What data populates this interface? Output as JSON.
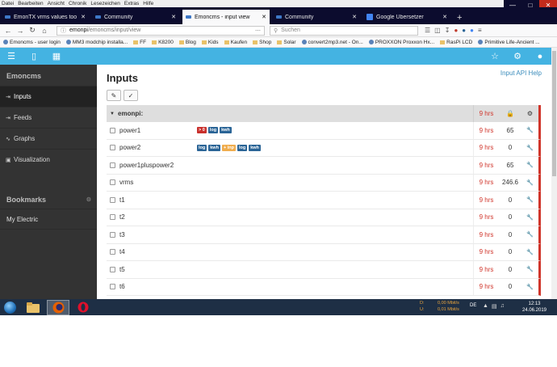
{
  "window_menu": [
    "Datei",
    "Bearbeiten",
    "Ansicht",
    "Chronik",
    "Lesezeichen",
    "Extras",
    "Hilfe"
  ],
  "tabs": [
    {
      "title": "EmonTX vrms values too large",
      "active": false
    },
    {
      "title": "Community",
      "active": false
    },
    {
      "title": "Emoncms - input view",
      "active": true
    },
    {
      "title": "Community",
      "active": false
    },
    {
      "title": "Google Übersetzer",
      "active": false
    }
  ],
  "url": {
    "host": "emonpi",
    "path": "/emoncms/input/view"
  },
  "search": {
    "placeholder": "Suchen"
  },
  "bookmarks": [
    {
      "label": "Emoncms - user login",
      "kind": "site"
    },
    {
      "label": "MM3 modchip installa...",
      "kind": "site"
    },
    {
      "label": "FF",
      "kind": "folder"
    },
    {
      "label": "K8200",
      "kind": "folder"
    },
    {
      "label": "Blog",
      "kind": "folder"
    },
    {
      "label": "Kids",
      "kind": "folder"
    },
    {
      "label": "Kaufen",
      "kind": "folder"
    },
    {
      "label": "Shop",
      "kind": "folder"
    },
    {
      "label": "Solar",
      "kind": "folder"
    },
    {
      "label": "convert2mp3.net - On...",
      "kind": "site"
    },
    {
      "label": "PROXXON Proxxon Hx...",
      "kind": "site"
    },
    {
      "label": "RasPi LCD",
      "kind": "folder"
    },
    {
      "label": "Primitive Life-Ancient ...",
      "kind": "site"
    }
  ],
  "sidebar": {
    "title": "Emoncms",
    "items": [
      {
        "label": "Inputs",
        "icon": "inputs-icon",
        "active": true
      },
      {
        "label": "Feeds",
        "icon": "feeds-icon",
        "active": false
      },
      {
        "label": "Graphs",
        "icon": "graphs-icon",
        "active": false
      },
      {
        "label": "Visualization",
        "icon": "visualization-icon",
        "active": false
      }
    ],
    "bookmarks_title": "Bookmarks",
    "bookmark_items": [
      "My Electric"
    ]
  },
  "main": {
    "title": "Inputs",
    "api_help": "Input API Help",
    "node": {
      "name": "emonpi:",
      "time": "9 hrs"
    },
    "rows": [
      {
        "name": "power1",
        "time": "9 hrs",
        "value": "65",
        "processes": [
          {
            "label": "> 0",
            "color": "#c9302c"
          },
          {
            "label": "log",
            "color": "#2a6496"
          },
          {
            "label": "kwh",
            "color": "#2a6496"
          }
        ]
      },
      {
        "name": "power2",
        "time": "9 hrs",
        "value": "0",
        "processes": [
          {
            "label": "log",
            "color": "#2a6496"
          },
          {
            "label": "kwh",
            "color": "#2a6496"
          },
          {
            "label": "+ inp",
            "color": "#f0ad4e"
          },
          {
            "label": "log",
            "color": "#2a6496"
          },
          {
            "label": "kwh",
            "color": "#2a6496"
          }
        ]
      },
      {
        "name": "power1pluspower2",
        "time": "9 hrs",
        "value": "65",
        "processes": []
      },
      {
        "name": "vrms",
        "time": "9 hrs",
        "value": "246.6",
        "processes": []
      },
      {
        "name": "t1",
        "time": "9 hrs",
        "value": "0",
        "processes": []
      },
      {
        "name": "t2",
        "time": "9 hrs",
        "value": "0",
        "processes": []
      },
      {
        "name": "t3",
        "time": "9 hrs",
        "value": "0",
        "processes": []
      },
      {
        "name": "t4",
        "time": "9 hrs",
        "value": "0",
        "processes": []
      },
      {
        "name": "t5",
        "time": "9 hrs",
        "value": "0",
        "processes": []
      },
      {
        "name": "t6",
        "time": "9 hrs",
        "value": "0",
        "processes": []
      }
    ]
  },
  "taskbar": {
    "net_down_label": "D:",
    "net_down": "0,00 Mbit/s",
    "net_up_label": "U:",
    "net_up": "0,01 Mbit/s",
    "lang": "DE",
    "time": "12:13",
    "date": "24.06.2019"
  },
  "colors": {
    "accent": "#44b3e2",
    "sidebar": "#333333",
    "status_red": "#d0352b"
  }
}
